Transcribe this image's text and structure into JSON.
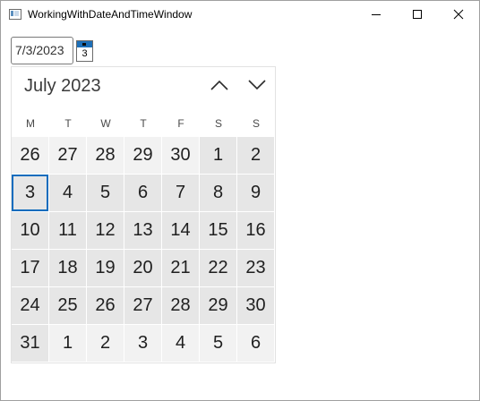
{
  "window": {
    "title": "WorkingWithDateAndTimeWindow"
  },
  "date_picker": {
    "text_value": "7/3/2023",
    "toggle_day": "3"
  },
  "calendar": {
    "month_title": "July 2023",
    "weekdays": [
      "M",
      "T",
      "W",
      "T",
      "F",
      "S",
      "S"
    ],
    "weeks": [
      [
        {
          "d": "26",
          "m": "other"
        },
        {
          "d": "27",
          "m": "other"
        },
        {
          "d": "28",
          "m": "other"
        },
        {
          "d": "29",
          "m": "other"
        },
        {
          "d": "30",
          "m": "other"
        },
        {
          "d": "1",
          "m": "current"
        },
        {
          "d": "2",
          "m": "current"
        }
      ],
      [
        {
          "d": "3",
          "m": "current",
          "sel": true
        },
        {
          "d": "4",
          "m": "current"
        },
        {
          "d": "5",
          "m": "current"
        },
        {
          "d": "6",
          "m": "current"
        },
        {
          "d": "7",
          "m": "current"
        },
        {
          "d": "8",
          "m": "current"
        },
        {
          "d": "9",
          "m": "current"
        }
      ],
      [
        {
          "d": "10",
          "m": "current"
        },
        {
          "d": "11",
          "m": "current"
        },
        {
          "d": "12",
          "m": "current"
        },
        {
          "d": "13",
          "m": "current"
        },
        {
          "d": "14",
          "m": "current"
        },
        {
          "d": "15",
          "m": "current"
        },
        {
          "d": "16",
          "m": "current"
        }
      ],
      [
        {
          "d": "17",
          "m": "current"
        },
        {
          "d": "18",
          "m": "current"
        },
        {
          "d": "19",
          "m": "current"
        },
        {
          "d": "20",
          "m": "current"
        },
        {
          "d": "21",
          "m": "current"
        },
        {
          "d": "22",
          "m": "current"
        },
        {
          "d": "23",
          "m": "current"
        }
      ],
      [
        {
          "d": "24",
          "m": "current"
        },
        {
          "d": "25",
          "m": "current"
        },
        {
          "d": "26",
          "m": "current"
        },
        {
          "d": "27",
          "m": "current"
        },
        {
          "d": "28",
          "m": "current"
        },
        {
          "d": "29",
          "m": "current"
        },
        {
          "d": "30",
          "m": "current"
        }
      ],
      [
        {
          "d": "31",
          "m": "current"
        },
        {
          "d": "1",
          "m": "other"
        },
        {
          "d": "2",
          "m": "other"
        },
        {
          "d": "3",
          "m": "other"
        },
        {
          "d": "4",
          "m": "other"
        },
        {
          "d": "5",
          "m": "other"
        },
        {
          "d": "6",
          "m": "other"
        }
      ]
    ]
  },
  "icons": {
    "minimize": "minimize-icon",
    "maximize": "maximize-icon",
    "close": "close-icon",
    "previous": "chevron-up-icon",
    "next": "chevron-down-icon"
  },
  "colors": {
    "accent": "#0f6cbd",
    "toggle_accent": "#1d6fb8",
    "current_month_bg": "#e6e6e6",
    "other_month_bg": "#f2f2f2"
  }
}
